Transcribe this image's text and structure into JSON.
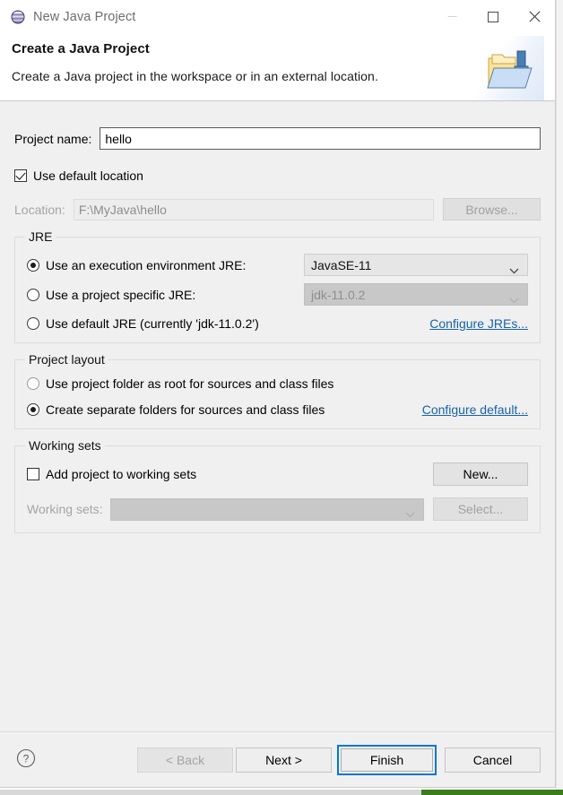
{
  "window": {
    "title": "New Java Project",
    "app_icon": "eclipse-sphere-icon",
    "controls": {
      "minimize": "minimize-icon",
      "maximize": "maximize-icon",
      "close": "close-icon"
    }
  },
  "header": {
    "title": "Create a Java Project",
    "description": "Create a Java project in the workspace or in an external location.",
    "icon": "java-project-folder-icon"
  },
  "form": {
    "project_name_label": "Project name:",
    "project_name_value": "hello",
    "project_name_placeholder": "",
    "use_default_location_label": "Use default location",
    "use_default_location_checked": true,
    "location_label": "Location:",
    "location_value": "F:\\MyJava\\hello",
    "browse_label": "Browse..."
  },
  "jre": {
    "group_title": "JRE",
    "option_execution_env_label": "Use an execution environment JRE:",
    "option_execution_env_selected": true,
    "execution_env_value": "JavaSE-11",
    "option_project_specific_label": "Use a project specific JRE:",
    "option_project_specific_selected": false,
    "project_specific_value": "jdk-11.0.2",
    "option_default_jre_label": "Use default JRE (currently 'jdk-11.0.2')",
    "option_default_jre_selected": false,
    "configure_link": "Configure JREs..."
  },
  "project_layout": {
    "group_title": "Project layout",
    "option_root_folder_label": "Use project folder as root for sources and class files",
    "option_root_folder_selected": false,
    "option_separate_folders_label": "Create separate folders for sources and class files",
    "option_separate_folders_selected": true,
    "configure_link": "Configure default..."
  },
  "working_sets": {
    "group_title": "Working sets",
    "add_to_working_sets_label": "Add project to working sets",
    "add_to_working_sets_checked": false,
    "working_sets_label": "Working sets:",
    "working_sets_value": "",
    "new_button": "New...",
    "select_button": "Select..."
  },
  "footer": {
    "help_icon": "help-icon",
    "back_label": "< Back",
    "next_label": "Next >",
    "finish_label": "Finish",
    "cancel_label": "Cancel"
  },
  "colors": {
    "accent": "#0078d7",
    "link": "#1764a8",
    "dialog_bg": "#f0f0f0",
    "header_bg": "#ffffff"
  }
}
